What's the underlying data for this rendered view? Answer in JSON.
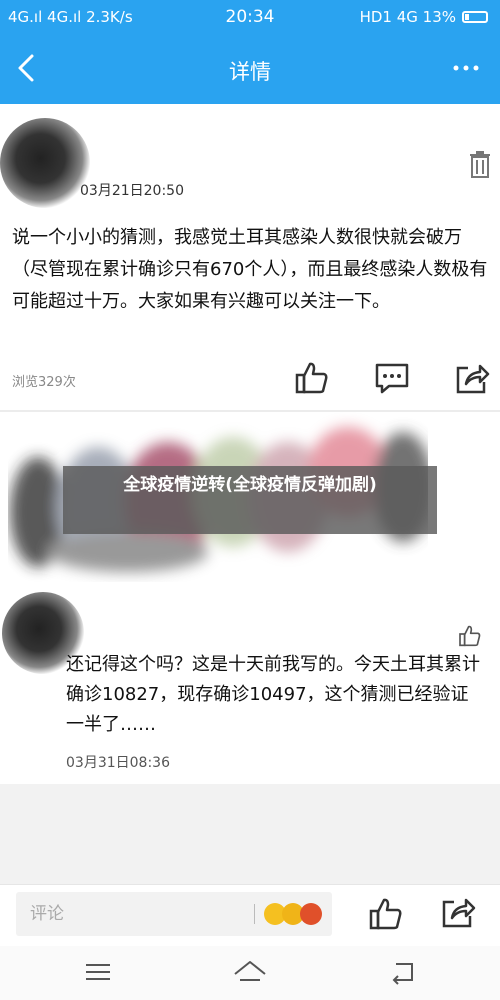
{
  "status_bar": {
    "signal_left": "4G.ıl 4G.ıl 2.3K/s",
    "time": "20:34",
    "right": "HD1 4G 13%"
  },
  "nav": {
    "back_icon": "chevron-left-icon",
    "title": "详情",
    "more_icon": "more-dots-icon"
  },
  "post1": {
    "timestamp": "03月21日20:50",
    "text": "说一个小小的猜测，我感觉土耳其感染人数很快就会破万（尽管现在累计确诊只有670个人），而且最终感染人数极有可能超过十万。大家如果有兴趣可以关注一下。",
    "views": "浏览329次",
    "icons": [
      "trash-icon",
      "like-icon",
      "comment-icon",
      "share-icon"
    ]
  },
  "overlay_headline": "全球疫情逆转(全球疫情反弹加剧)",
  "post2": {
    "text": "还记得这个吗？这是十天前我写的。今天土耳其累计确诊10827，现存确诊10497，这个猜测已经验证一半了……",
    "timestamp": "03月31日08:36",
    "icons": [
      "like-icon"
    ]
  },
  "bottom_bar": {
    "comment_placeholder": "评论",
    "icons": [
      "emoji-icon",
      "like-icon",
      "share-icon"
    ]
  },
  "system_nav": {
    "icons": [
      "menu-icon",
      "home-icon",
      "back-icon"
    ]
  },
  "colors": {
    "accent": "#2aa3f0",
    "background": "#f2f2f2"
  }
}
